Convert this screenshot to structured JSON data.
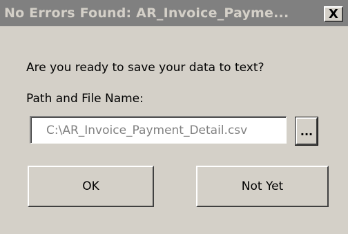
{
  "window": {
    "title": "No Errors Found: AR_Invoice_Payme...",
    "close_icon": "close-icon",
    "close_glyph": "X"
  },
  "dialog": {
    "question": "Are you ready to save your data to text?",
    "path_label": "Path and File Name:",
    "path_value": "C:\\AR_Invoice_Payment_Detail.csv",
    "browse_label": "...",
    "ok_label": "OK",
    "not_yet_label": "Not Yet"
  },
  "colors": {
    "face": "#d4d0c8",
    "titlebar_inactive": "#808080",
    "title_text": "#d4d0c8",
    "input_text_disabled": "#808080"
  }
}
